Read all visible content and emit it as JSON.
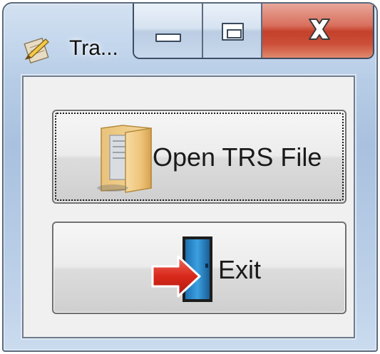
{
  "window": {
    "title": "Tra...",
    "icons": {
      "app": "notepad-pencil-icon",
      "minimize": "minimize-icon",
      "maximize": "maximize-icon",
      "close": "close-icon"
    },
    "colors": {
      "frame": "#b6cce6",
      "close_button": "#c4402a"
    }
  },
  "buttons": {
    "open_trs": {
      "label": "Open TRS File",
      "icon": "folder-documents-icon",
      "focused": true
    },
    "exit": {
      "label": "Exit",
      "icon": "exit-door-arrow-icon"
    }
  }
}
